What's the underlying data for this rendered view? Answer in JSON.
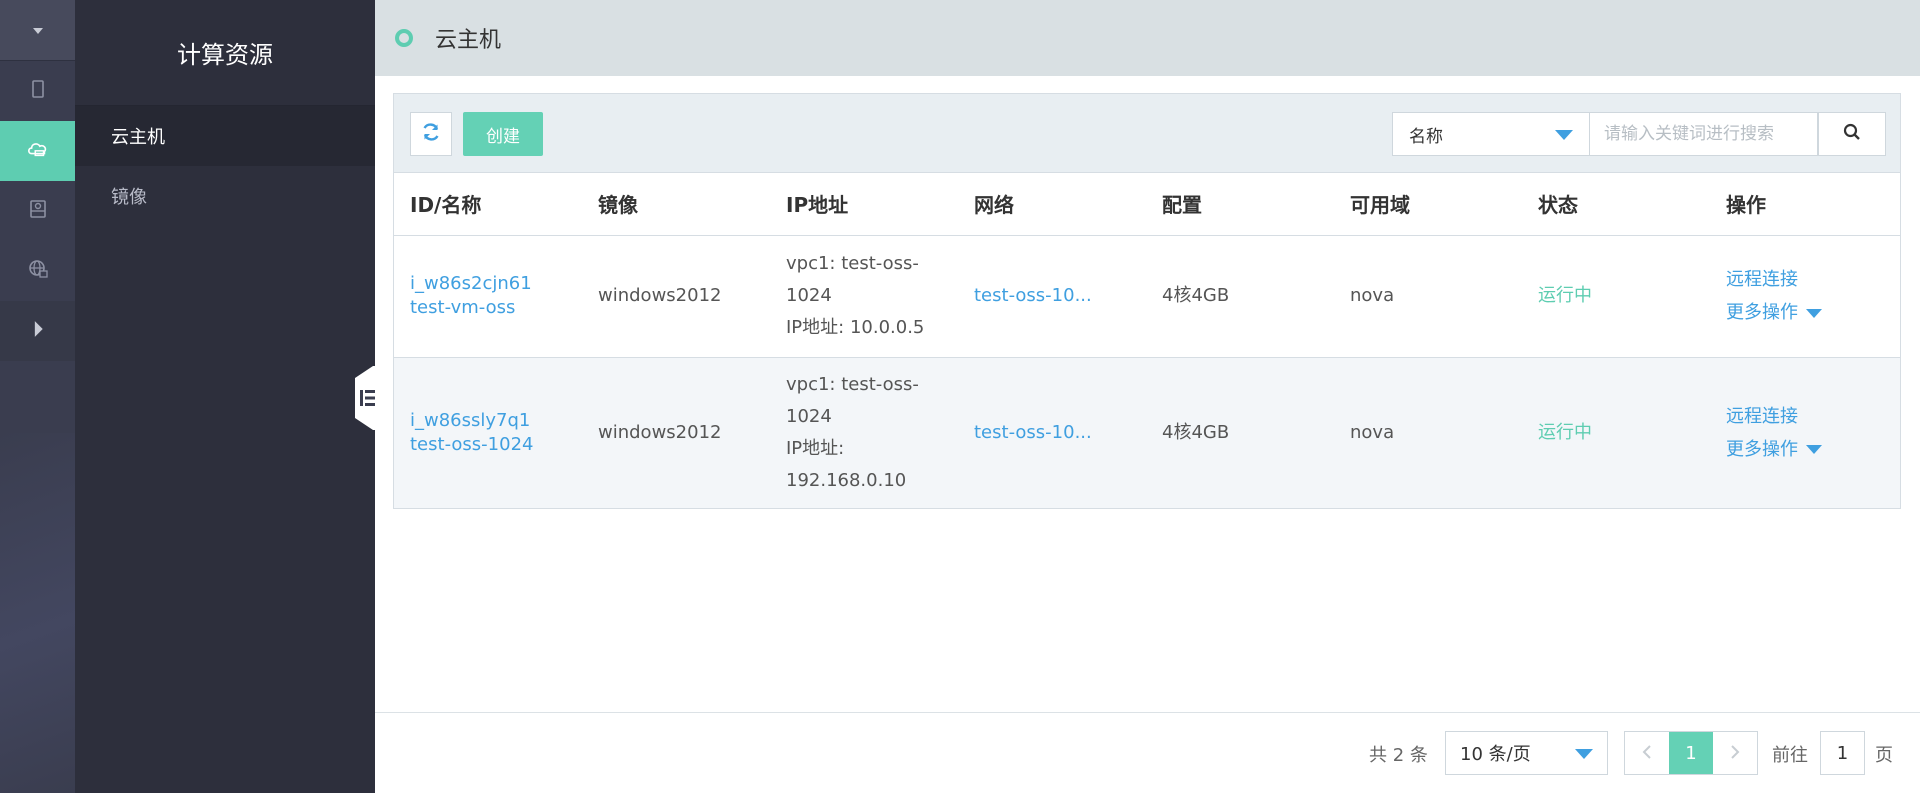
{
  "sidebar": {
    "title": "计算资源",
    "items": [
      {
        "label": "云主机",
        "active": true
      },
      {
        "label": "镜像",
        "active": false
      }
    ]
  },
  "rail": {
    "icons": [
      "chevron-down-icon",
      "server-icon",
      "cloud-host-icon",
      "disk-icon",
      "globe-icon",
      "chevron-right-icon"
    ],
    "accent": "#5ecdb1"
  },
  "header": {
    "title": "云主机"
  },
  "toolbar": {
    "create_label": "创建",
    "filter_selected": "名称",
    "search_placeholder": "请输入关键词进行搜索"
  },
  "table": {
    "columns": [
      "ID/名称",
      "镜像",
      "IP地址",
      "网络",
      "配置",
      "可用域",
      "状态",
      "操作"
    ],
    "rows": [
      {
        "id": "i_w86s2cjn61",
        "name": "test-vm-oss",
        "image": "windows2012",
        "ip_vpc": "vpc1: test-oss-1024",
        "ip_addr": "IP地址: 10.0.0.5",
        "network": "test-oss-10...",
        "config": "4核4GB",
        "zone": "nova",
        "status": "运行中",
        "op_connect": "远程连接",
        "op_more": "更多操作"
      },
      {
        "id": "i_w86ssly7q1",
        "name": "test-oss-1024",
        "image": "windows2012",
        "ip_vpc": "vpc1: test-oss-1024",
        "ip_addr": "IP地址: 192.168.0.10",
        "network": "test-oss-10...",
        "config": "4核4GB",
        "zone": "nova",
        "status": "运行中",
        "op_connect": "远程连接",
        "op_more": "更多操作"
      }
    ]
  },
  "pagination": {
    "total_text": "共 2 条",
    "page_size": "10 条/页",
    "current_page": "1",
    "goto_label": "前往",
    "goto_value": "1",
    "page_unit": "页"
  },
  "colors": {
    "accent": "#5ecdb1",
    "link": "#3f9fe0",
    "sidebar_bg": "#2d2f3c",
    "rail_bg": "#3a3d4f"
  }
}
